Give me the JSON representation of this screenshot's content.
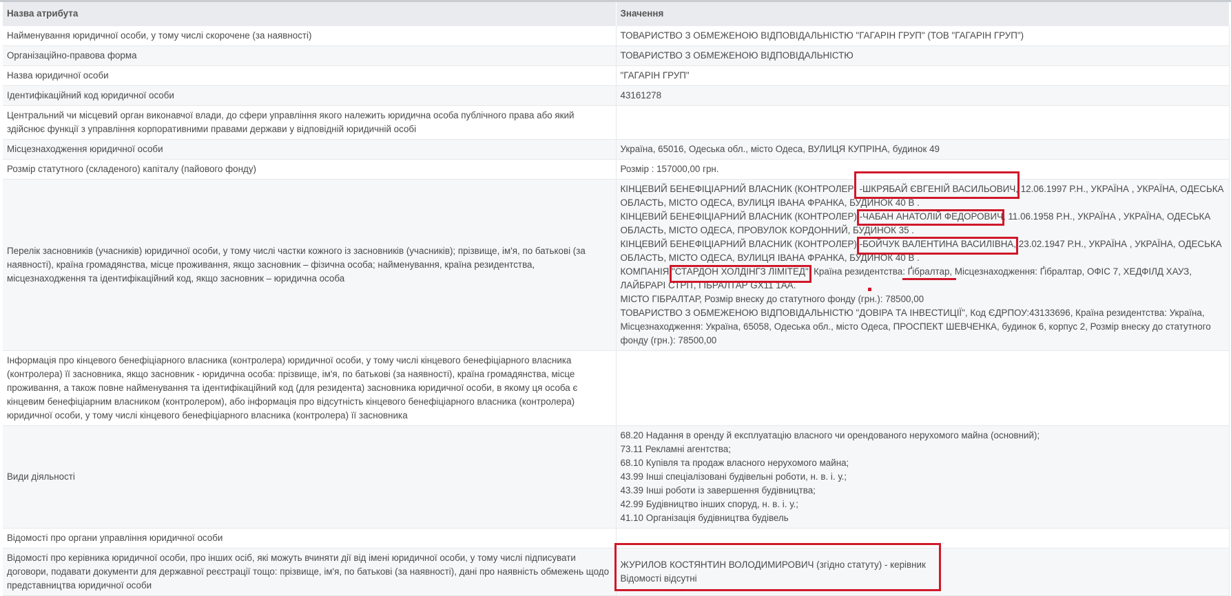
{
  "table": {
    "header": {
      "attribute": "Назва атрибута",
      "value": "Значення"
    },
    "rows": [
      {
        "attribute": "Найменування юридичної особи, у тому числі скорочене (за наявності)",
        "value": [
          "ТОВАРИСТВО З ОБМЕЖЕНОЮ ВІДПОВІДАЛЬНІСТЮ \"ГАГАРІН ГРУП\" (ТОВ \"ГАГАРІН ГРУП\")"
        ]
      },
      {
        "attribute": "Організаційно-правова форма",
        "value": [
          "ТОВАРИСТВО З ОБМЕЖЕНОЮ ВІДПОВІДАЛЬНІСТЮ"
        ]
      },
      {
        "attribute": "Назва юридичної особи",
        "value": [
          "\"ГАГАРІН ГРУП\""
        ]
      },
      {
        "attribute": "Ідентифікаційний код юридичної особи",
        "value": [
          "43161278"
        ]
      },
      {
        "attribute": "Центральний чи місцевий орган виконавчої влади, до сфери управління якого належить юридична особа публічного права або який здійснює функції з управління корпоративними правами держави у відповідній юридичній особі",
        "value": []
      },
      {
        "attribute": "Місцезнаходження юридичної особи",
        "value": [
          "Україна, 65016, Одеська обл., місто Одеса, ВУЛИЦЯ КУПРІНА, будинок 49"
        ]
      },
      {
        "attribute": "Розмір статутного (складеного) капіталу (пайового фонду)",
        "value": [
          "Розмір : 157000,00 грн."
        ]
      },
      {
        "attribute": "Перелік засновників (учасників) юридичної особи, у тому числі частки кожного із засновників (учасників); прізвище, ім'я, по батькові (за наявності), країна громадянства, місце проживання, якщо засновник – фізична особа; найменування, країна резидентства, місцезнаходження та ідентифікаційний код, якщо засновник – юридична особа",
        "value": [
          "КІНЦЕВИЙ БЕНЕФІЦІАРНИЙ ВЛАСНИК (КОНТРОЛЕР) -ШКРЯБАЙ ЄВГЕНІЙ ВАСИЛЬОВИЧ, 12.06.1997 Р.Н., УКРАЇНА , УКРАЇНА, ОДЕСЬКА ОБЛАСТЬ, МІСТО ОДЕСА, ВУЛИЦЯ ІВАНА ФРАНКА, БУДИНОК 40 В .",
          "КІНЦЕВИЙ БЕНЕФІЦІАРНИЙ ВЛАСНИК (КОНТРОЛЕР) -ЧАБАН АНАТОЛІЙ ФЕДОРОВИЧ, 11.06.1958 Р.Н., УКРАЇНА , УКРАЇНА, ОДЕСЬКА ОБЛАСТЬ, МІСТО ОДЕСА, ПРОВУЛОК КОРДОННИЙ, БУДИНОК 35 .",
          "КІНЦЕВИЙ БЕНЕФІЦІАРНИЙ ВЛАСНИК (КОНТРОЛЕР) -БОЙЧУК ВАЛЕНТИНА ВАСИЛІВНА, 23.02.1947 Р.Н., УКРАЇНА , УКРАЇНА, ОДЕСЬКА ОБЛАСТЬ, МІСТО ОДЕСА, ВУЛИЦЯ ІВАНА ФРАНКА, БУДИНОК 40 В .",
          "КОМПАНІЯ \"СТАРДОН ХОЛДІНГЗ ЛІМІТЕД\", Країна резидентства: Ґібралтар, Місцезнаходження: Ґібралтар, ОФІС 7, ХЕДФІЛД ХАУЗ, ЛАЙБРАРІ СТРІТ, ГІБРАЛТАР GX11 1AA.",
          "МІСТО ГІБРАЛТАР, Розмір внеску до статутного фонду (грн.): 78500,00",
          "ТОВАРИСТВО З ОБМЕЖЕНОЮ ВІДПОВІДАЛЬНІСТЮ \"ДОВІРА ТА ІНВЕСТИЦІЇ\", Код ЄДРПОУ:43133696, Країна резидентства: Україна, Місцезнаходження: Україна, 65058, Одеська обл., місто Одеса, ПРОСПЕКТ ШЕВЧЕНКА, будинок 6, корпус 2, Розмір внеску до статутного фонду (грн.): 78500,00"
        ]
      },
      {
        "attribute": "Інформація про кінцевого бенефіціарного власника (контролера) юридичної особи, у тому числі кінцевого бенефіціарного власника (контролера) її засновника, якщо засновник - юридична особа: прізвище, ім'я, по батькові (за наявності), країна громадянства, місце проживання, а також повне найменування та ідентифікаційний код (для резидента) засновника юридичної особи, в якому ця особа є кінцевим бенефіціарним власником (контролером), або інформація про відсутність кінцевого бенефіціарного власника (контролера) юридичної особи, у тому числі кінцевого бенефіціарного власника (контролера) її засновника",
        "value": []
      },
      {
        "attribute": "Види діяльності",
        "value": [
          "68.20 Надання в оренду й експлуатацію власного чи орендованого нерухомого майна (основний);",
          "73.11 Рекламні агентства;",
          "68.10 Купівля та продаж власного нерухомого майна;",
          "43.99 Інші спеціалізовані будівельні роботи, н. в. і. у.;",
          "43.39 Інші роботи із завершення будівництва;",
          "42.99 Будівництво інших споруд, н. в. і. у.;",
          "41.10 Організація будівництва будівель"
        ]
      },
      {
        "attribute": "Відомості про органи управління юридичної особи",
        "value": []
      },
      {
        "attribute": "Відомості про керівника юридичної особи, про інших осіб, які можуть вчиняти дії від імені юридичної особи, у тому числі підписувати договори, подавати документи для державної реєстрації тощо: прізвище, ім'я, по батькові (за наявності), дані про наявність обмежень щодо представництва юридичної особи",
        "value": [
          "ЖУРИЛОВ КОСТЯНТИН ВОЛОДИМИРОВИЧ (згідно статуту) - керівник",
          "Відомості відсутні"
        ]
      }
    ]
  },
  "highlight_color": "#d0182a"
}
